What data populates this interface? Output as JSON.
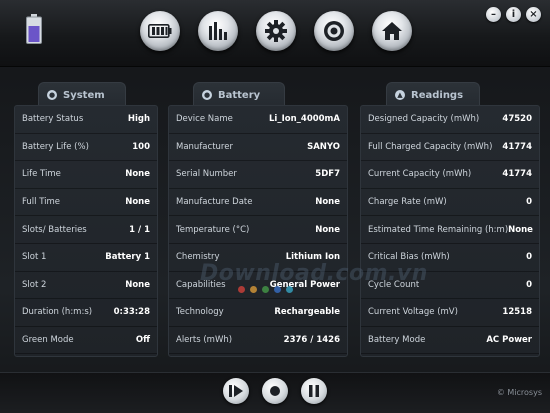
{
  "toolbar": {
    "nav": [
      {
        "name": "battery-nav-icon"
      },
      {
        "name": "chart-nav-icon"
      },
      {
        "name": "settings-nav-icon"
      },
      {
        "name": "target-nav-icon"
      },
      {
        "name": "home-nav-icon"
      }
    ],
    "window": {
      "minimize": "–",
      "info": "i",
      "close": "×"
    }
  },
  "system": {
    "title": "System",
    "rows": [
      {
        "label": "Battery Status",
        "value": "High"
      },
      {
        "label": "Battery Life (%)",
        "value": "100"
      },
      {
        "label": "Life Time",
        "value": "None"
      },
      {
        "label": "Full Time",
        "value": "None"
      },
      {
        "label": "Slots/ Batteries",
        "value": "1 / 1"
      },
      {
        "label": "Slot 1",
        "value": "Battery 1"
      },
      {
        "label": "Slot 2",
        "value": "None"
      },
      {
        "label": "Duration (h:m:s)",
        "value": "0:33:28"
      },
      {
        "label": "Green Mode",
        "value": "Off"
      }
    ]
  },
  "battery": {
    "title": "Battery",
    "rows": [
      {
        "label": "Device Name",
        "value": "Li_Ion_4000mA"
      },
      {
        "label": "Manufacturer",
        "value": "SANYO"
      },
      {
        "label": "Serial Number",
        "value": "5DF7"
      },
      {
        "label": "Manufacture Date",
        "value": "None"
      },
      {
        "label": "Temperature (°C)",
        "value": "None"
      },
      {
        "label": "Chemistry",
        "value": "Lithium Ion"
      },
      {
        "label": "Capabilities",
        "value": "General Power"
      },
      {
        "label": "Technology",
        "value": "Rechargeable"
      },
      {
        "label": "Alerts (mWh)",
        "value": "2376 / 1426"
      }
    ]
  },
  "readings": {
    "title": "Readings",
    "rows": [
      {
        "label": "Designed Capacity  (mWh)",
        "value": "47520"
      },
      {
        "label": "Full Charged Capacity (mWh)",
        "value": "41774"
      },
      {
        "label": "Current Capacity (mWh)",
        "value": "41774"
      },
      {
        "label": "Charge Rate (mW)",
        "value": "0"
      },
      {
        "label": "Estimated Time Remaining (h:m)",
        "value": "None"
      },
      {
        "label": "Critical Bias (mWh)",
        "value": "0"
      },
      {
        "label": "Cycle Count",
        "value": "0"
      },
      {
        "label": "Current Voltage (mV)",
        "value": "12518"
      },
      {
        "label": "Battery Mode",
        "value": "AC Power"
      }
    ]
  },
  "footer": {
    "copyright": "© Microsys",
    "watermark": "Download.com.vn"
  },
  "colors": {
    "accent_battery": "#6b55c8",
    "dots": [
      "#e8453c",
      "#f2a93b",
      "#4aa84b",
      "#3b78d8",
      "#3bb7d8"
    ]
  }
}
